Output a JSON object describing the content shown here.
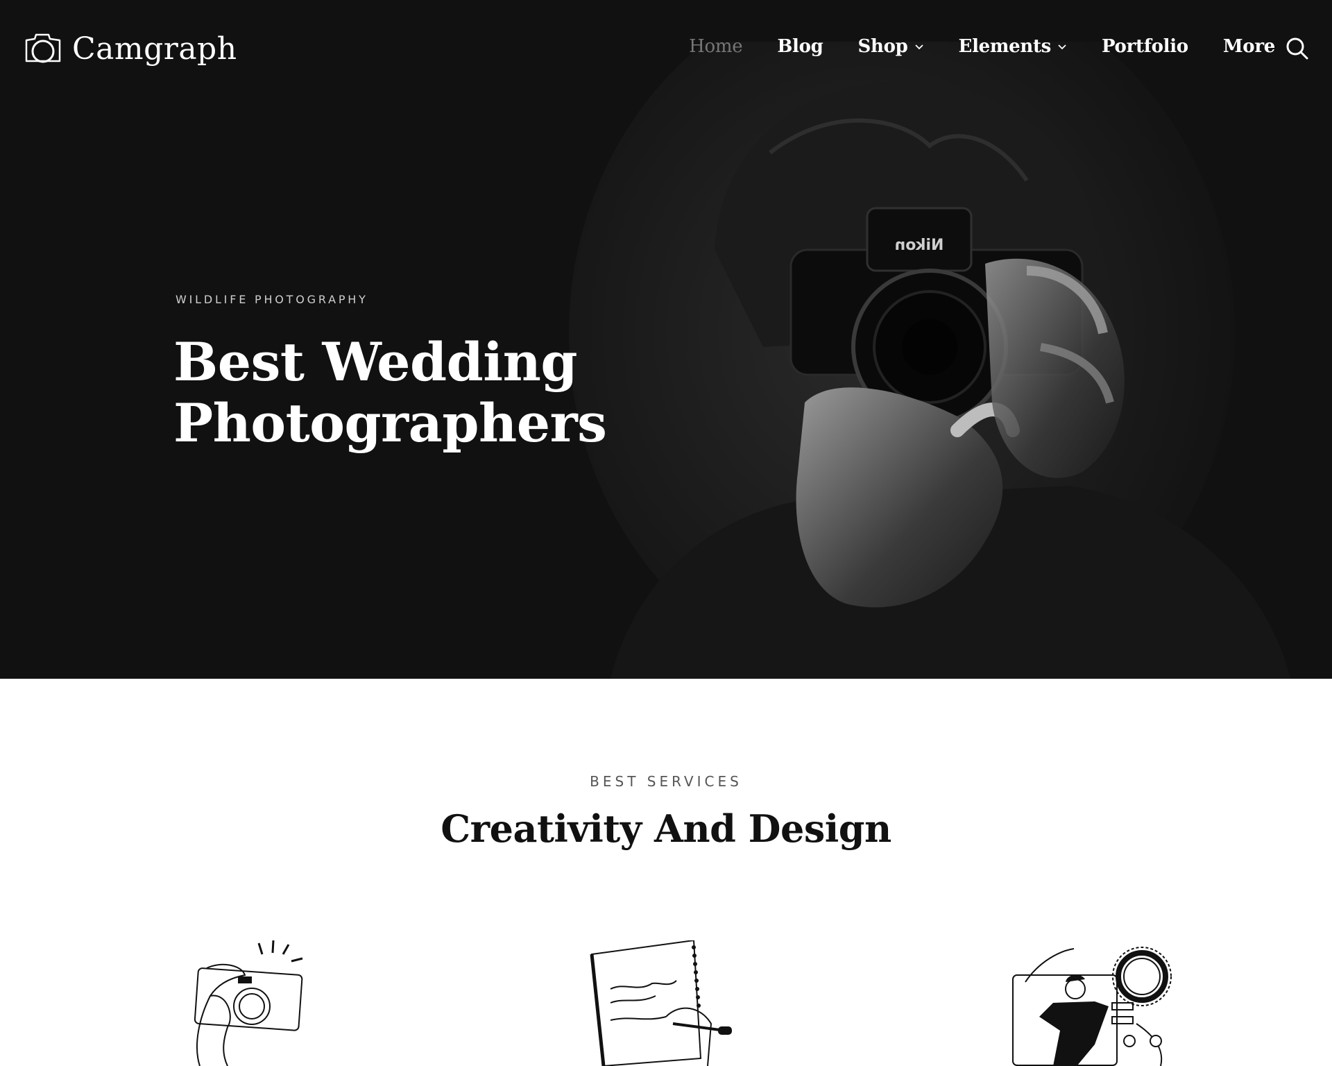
{
  "brand": {
    "name": "Camgraph",
    "logo_icon": "camera-outline-icon"
  },
  "nav": {
    "items": [
      {
        "label": "Home",
        "active": true,
        "has_dropdown": false
      },
      {
        "label": "Blog",
        "active": false,
        "has_dropdown": false
      },
      {
        "label": "Shop",
        "active": false,
        "has_dropdown": true
      },
      {
        "label": "Elements",
        "active": false,
        "has_dropdown": true
      },
      {
        "label": "Portfolio",
        "active": false,
        "has_dropdown": false
      },
      {
        "label": "More",
        "active": false,
        "has_dropdown": false
      }
    ],
    "search_icon": "search-icon"
  },
  "hero": {
    "eyebrow": "WILDLIFE PHOTOGRAPHY",
    "title_line1": "Best Wedding",
    "title_line2": "Photographers",
    "camera_brand": "Nikon",
    "background_color": "#111111"
  },
  "services": {
    "eyebrow": "BEST SERVICES",
    "title": "Creativity And Design",
    "items": [
      {
        "illustration": "hand-holding-camera-illustration"
      },
      {
        "illustration": "hand-writing-notebook-illustration"
      },
      {
        "illustration": "team-dashboard-illustration"
      }
    ]
  },
  "colors": {
    "hero_bg": "#111111",
    "nav_active": "#777777",
    "text_light": "#ffffff",
    "page_bg": "#ffffff"
  }
}
